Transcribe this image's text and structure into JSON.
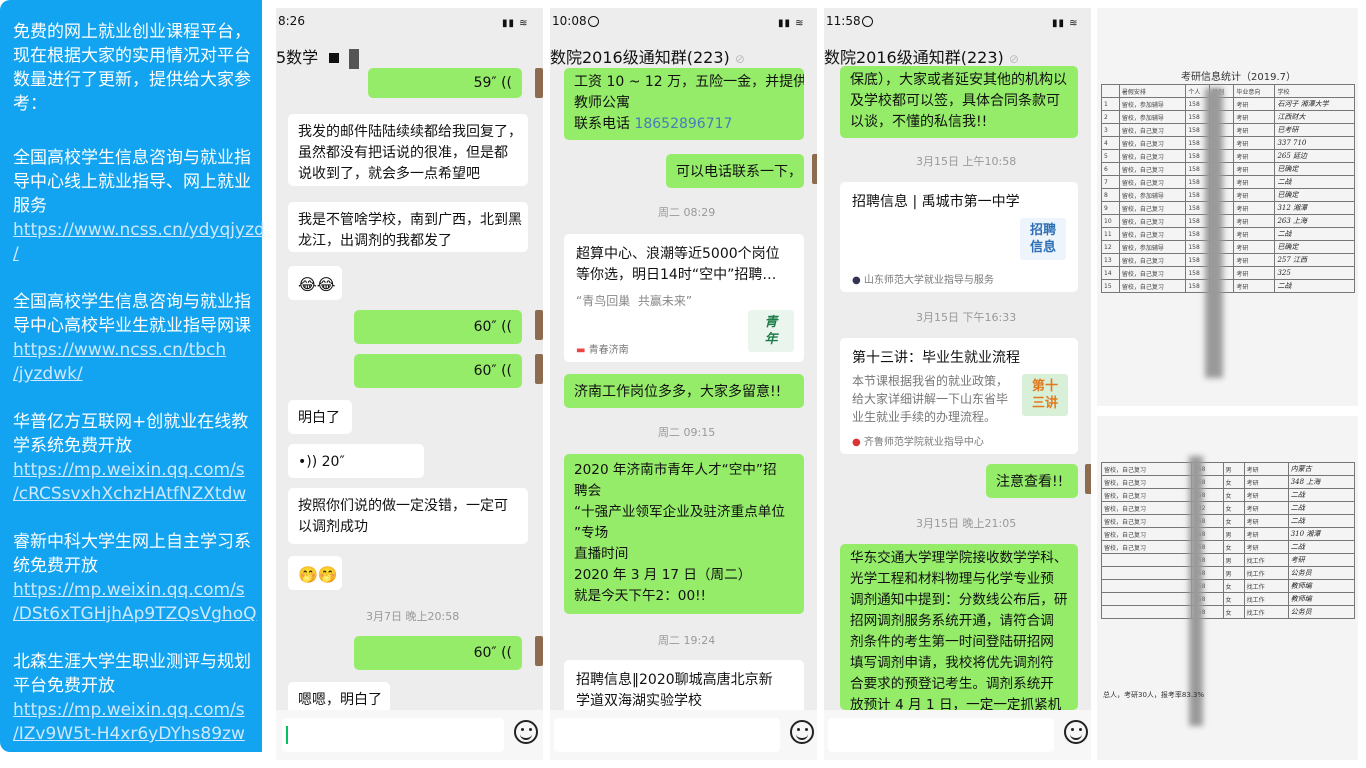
{
  "panel1": {
    "intro": "免费的网上就业创业课程平台，\n现在根据大家的实用情况对平台\n数量进行了更新，提供给大家参\n考：",
    "items": [
      {
        "name": "全国高校学生信息咨询与就业指\n导中心线上就业指导、网上就业\n服务",
        "link": "https://www.ncss.cn/ydyqjyzd\n/"
      },
      {
        "name": "全国高校学生信息咨询与就业指\n导中心高校毕业生就业指导网课",
        "link": "https://www.ncss.cn/tbch\n/jyzdwk/"
      },
      {
        "name": "华普亿方互联网+创就业在线教\n学系统免费开放",
        "link": "https://mp.weixin.qq.com/s\n/cRCSsvxhXchzHAtfNZXtdw"
      },
      {
        "name": "睿新中科大学生网上自主学习系\n统免费开放",
        "link": "https://mp.weixin.qq.com/s\n/DSt6xTGHjhAp9TZQsVghoQ"
      },
      {
        "name": "北森生涯大学生职业测评与规划\n平台免费开放",
        "link": "https://mp.weixin.qq.com/s\n/IZv9W5t-H4xr6yDYhs89zw"
      }
    ]
  },
  "panel2": {
    "time": "8:26",
    "title": "5数学",
    "voice_59": "59″",
    "msg1": "我发的邮件陆陆续续都给我回复了，\n虽然都没有把话说的很准，但是都\n说收到了，就会多一点希望吧",
    "msg2": "我是不管啥学校，南到广西，北到黑\n龙江，出调剂的我都发了",
    "emoji1": "😂😂",
    "voice_60a": "60″",
    "voice_60b": "60″",
    "msg3": "明白了",
    "voice_20": "20″",
    "msg4": "按照你们说的做一定没错，一定可\n以调剂成功",
    "emoji2": "🤭🤭",
    "ts1": "3月7日 晚上20:58",
    "voice_60c": "60″",
    "msg5": "嗯嗯，明白了"
  },
  "panel3": {
    "time": "10:08",
    "title": "数院2016级通知群(223)",
    "msg1_a": "工资 10 ~ 12 万，五险一金，并提供\n教师公寓\n联系电话 ",
    "msg1_phone": "18652896717",
    "msg2": "可以电话联系一下，",
    "ts1": "周二 08:29",
    "card1_title": "超算中心、浪潮等近5000个岗位\n等你选，明日14时“空中”招聘…",
    "card1_desc": "“青鸟回巢  共赢未来”",
    "card1_src": "青春济南",
    "card1_thumb": "青\n年",
    "msg3": "济南工作岗位多多，大家多留意!!",
    "ts2": "周二 09:15",
    "msg4": "2020 年济南市青年人才“空中”招\n聘会\n“十强产业领军企业及驻济重点单位\n”专场\n直播时间\n2020 年 3 月 17 日（周二）\n就是今天下午2：00!!",
    "ts3": "周二 19:24",
    "card2_title": "招聘信息‖2020聊城高唐北京新\n学道双海湖实验学校"
  },
  "panel4": {
    "time": "11:58",
    "title": "数院2016级通知群(223)",
    "msg1": "保底），大家或者延安其他的机构以\n及学校都可以签，具体合同条款可\n以谈，不懂的私信我!!",
    "ts1": "3月15日 上午10:58",
    "card1_title": "招聘信息 | 禹城市第一中学",
    "card1_thumb": "招聘\n信息",
    "card1_src": "山东师范大学就业指导与服务",
    "ts2": "3月15日 下午16:33",
    "card2_title": "第十三讲：毕业生就业流程",
    "card2_desc": "本节课根据我省的就业政策，\n给大家详细讲解一下山东省毕\n业生就业手续的办理流程。",
    "card2_thumb": "第十\n三讲",
    "card2_src": "齐鲁师范学院就业指导中心",
    "msg2": "注意查看!!",
    "ts3": "3月15日 晚上21:05",
    "msg3": "华东交通大学理学院接收数学学科、\n光学工程和材料物理与化学专业预\n调剂通知中提到：分数线公布后，研\n招网调剂服务系统开通，请符合调\n剂条件的考生第一时间登陆研招网\n填写调剂申请，我校将优先调剂符\n合要求的预登记考生。调剂系统开\n放预计 4 月 1 日，一定一定抓紧机"
  },
  "photo1": {
    "title": "考研信息统计（2019.7）",
    "headers": [
      "",
      "暑假安排",
      "个人",
      "性别",
      "毕业意向",
      "学校"
    ],
    "rows": [
      [
        "1",
        "留校，参加辅导",
        "158",
        "男",
        "考研",
        "石河子 湘潭大学"
      ],
      [
        "2",
        "留校，参加辅导",
        "158",
        "男",
        "考研",
        "江西财大"
      ],
      [
        "3",
        "留校，自己复习",
        "158",
        "男",
        "考研",
        "已考研"
      ],
      [
        "4",
        "留校，自己复习",
        "158",
        "女",
        "考研",
        "337 710"
      ],
      [
        "5",
        "留校，自己复习",
        "158",
        "女",
        "考研",
        "265 延边"
      ],
      [
        "6",
        "留校，自己复习",
        "158",
        "女",
        "考研",
        "已确定"
      ],
      [
        "7",
        "留校，自己复习",
        "158",
        "女",
        "考研",
        "二战"
      ],
      [
        "8",
        "留校，参加辅导",
        "158",
        "女",
        "考研",
        "已确定"
      ],
      [
        "9",
        "留校，自己复习",
        "158",
        "男",
        "考研",
        "312 湘潭"
      ],
      [
        "10",
        "留校，自己复习",
        "158",
        "女",
        "考研",
        "263 上海"
      ],
      [
        "11",
        "留校，自己复习",
        "158",
        "女",
        "考研",
        "二战"
      ],
      [
        "12",
        "留校，参加辅导",
        "158",
        "男",
        "考研",
        "已确定"
      ],
      [
        "13",
        "留校，自己复习",
        "158",
        "女",
        "考研",
        "257 江西"
      ],
      [
        "14",
        "留校，自己复习",
        "158",
        "女",
        "考研",
        "325"
      ],
      [
        "15",
        "留校，自己复习",
        "158",
        "女",
        "考研",
        "二战"
      ]
    ]
  },
  "photo2": {
    "rows": [
      [
        "留校，自己复习",
        "158",
        "男",
        "考研",
        "内蒙古"
      ],
      [
        "留校，自己复习",
        "158",
        "女",
        "考研",
        "348 上海"
      ],
      [
        "留校，自己复习",
        "158",
        "女",
        "考研",
        "二战"
      ],
      [
        "留校，自己复习",
        "132",
        "女",
        "考研",
        "二战"
      ],
      [
        "留校，自己复习",
        "158",
        "女",
        "考研",
        "二战"
      ],
      [
        "留校，自己复习",
        "158",
        "男",
        "考研",
        "310 湘潭"
      ],
      [
        "留校，自己复习",
        "158",
        "女",
        "考研",
        "二战"
      ],
      [
        "",
        "158",
        "男",
        "找工作",
        "考研"
      ],
      [
        "",
        "158",
        "男",
        "找工作",
        "公务员"
      ],
      [
        "",
        "158",
        "女",
        "找工作",
        "教师编"
      ],
      [
        "",
        "158",
        "女",
        "找工作",
        "教师编"
      ],
      [
        "",
        "158",
        "女",
        "找工作",
        "公务员"
      ]
    ],
    "footer": "总人，考研30人，报考率83.3%"
  }
}
